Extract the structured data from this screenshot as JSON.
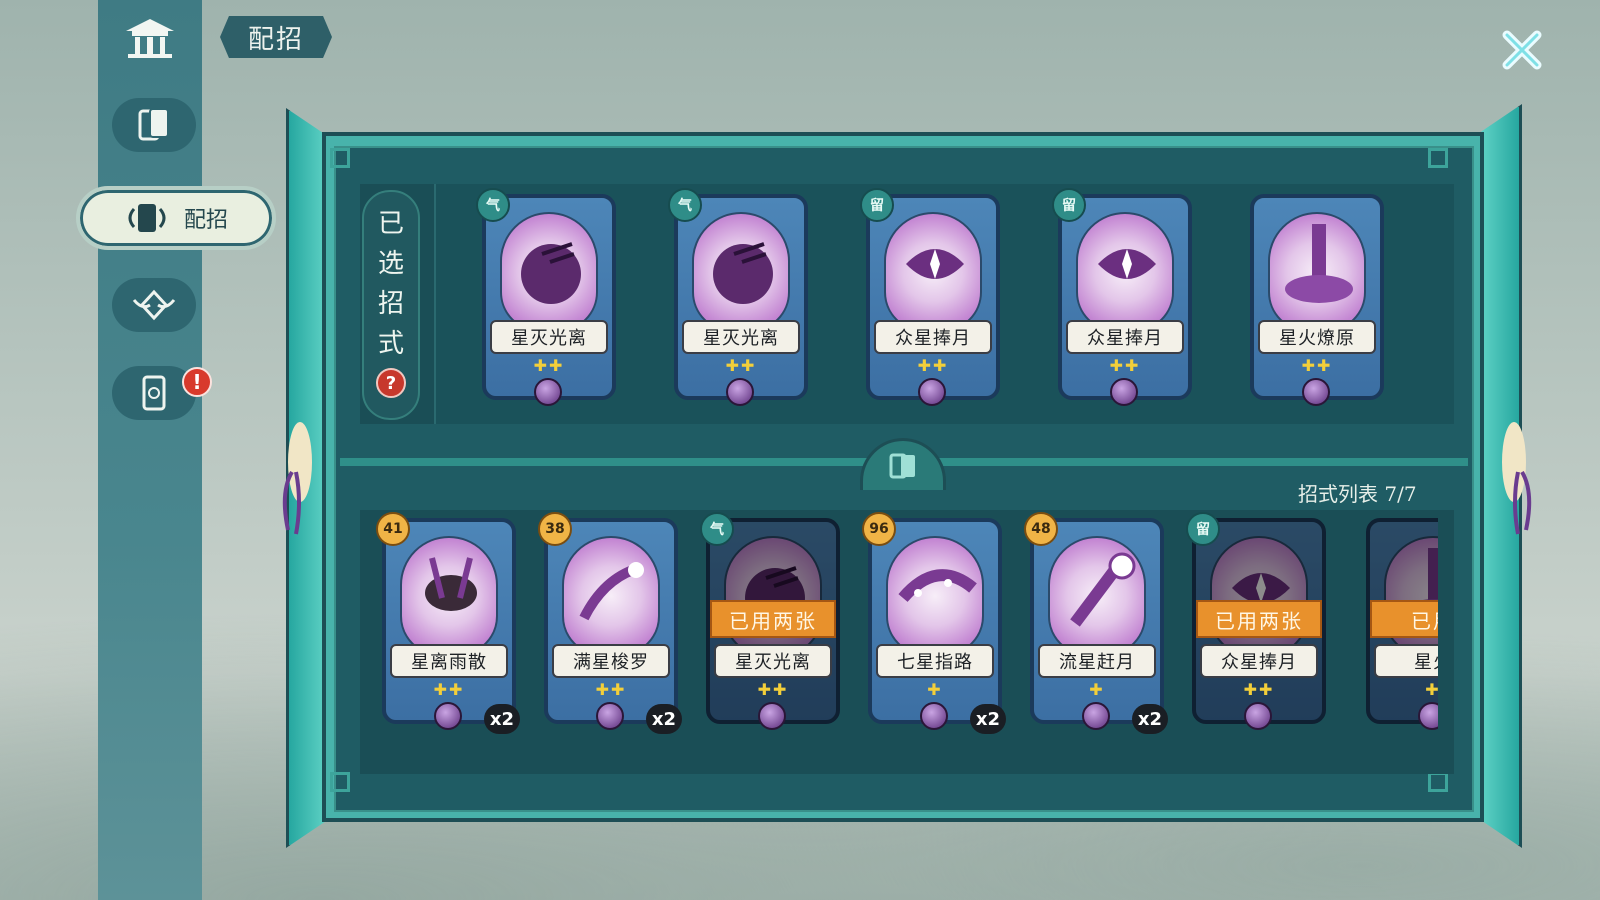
{
  "header": {
    "title": "配招"
  },
  "sidebar": {
    "items": [
      {
        "name": "temple"
      },
      {
        "name": "cards"
      },
      {
        "name": "loadout",
        "label": "配招",
        "active": true
      },
      {
        "name": "emblem"
      },
      {
        "name": "deck",
        "alert": "!"
      }
    ]
  },
  "panel": {
    "selected_label": [
      "已",
      "选",
      "招",
      "式"
    ],
    "help": "?",
    "list_label": "招式列表 7/7"
  },
  "selected_cards": [
    {
      "name": "星灭光离",
      "badge": "气",
      "badge_type": "teal",
      "pips": "✚✚"
    },
    {
      "name": "星灭光离",
      "badge": "气",
      "badge_type": "teal",
      "pips": "✚✚"
    },
    {
      "name": "众星捧月",
      "badge": "留",
      "badge_type": "teal",
      "pips": "✚✚"
    },
    {
      "name": "众星捧月",
      "badge": "留",
      "badge_type": "teal",
      "pips": "✚✚"
    },
    {
      "name": "星火燎原",
      "badge": "",
      "badge_type": "",
      "pips": "✚✚"
    }
  ],
  "list_cards": [
    {
      "name": "星离雨散",
      "badge": "41",
      "badge_type": "gold",
      "pips": "✚✚",
      "count": "x2",
      "used": ""
    },
    {
      "name": "满星梭罗",
      "badge": "38",
      "badge_type": "gold",
      "pips": "✚✚",
      "count": "x2",
      "used": ""
    },
    {
      "name": "星灭光离",
      "badge": "气",
      "badge_type": "teal",
      "pips": "✚✚",
      "count": "",
      "used": "已用两张"
    },
    {
      "name": "七星指路",
      "badge": "96",
      "badge_type": "gold",
      "pips": "✚",
      "count": "x2",
      "used": ""
    },
    {
      "name": "流星赶月",
      "badge": "48",
      "badge_type": "gold",
      "pips": "✚",
      "count": "x2",
      "used": ""
    },
    {
      "name": "众星捧月",
      "badge": "留",
      "badge_type": "teal",
      "pips": "✚✚",
      "count": "",
      "used": "已用两张"
    },
    {
      "name": "星火",
      "badge": "",
      "badge_type": "",
      "pips": "✚",
      "count": "",
      "used": "已用"
    }
  ],
  "colors": {
    "panel_teal": "#48b3ab",
    "card_blue": "#4d86b8",
    "used_orange": "#e8912c",
    "alert_red": "#d83a2c"
  }
}
